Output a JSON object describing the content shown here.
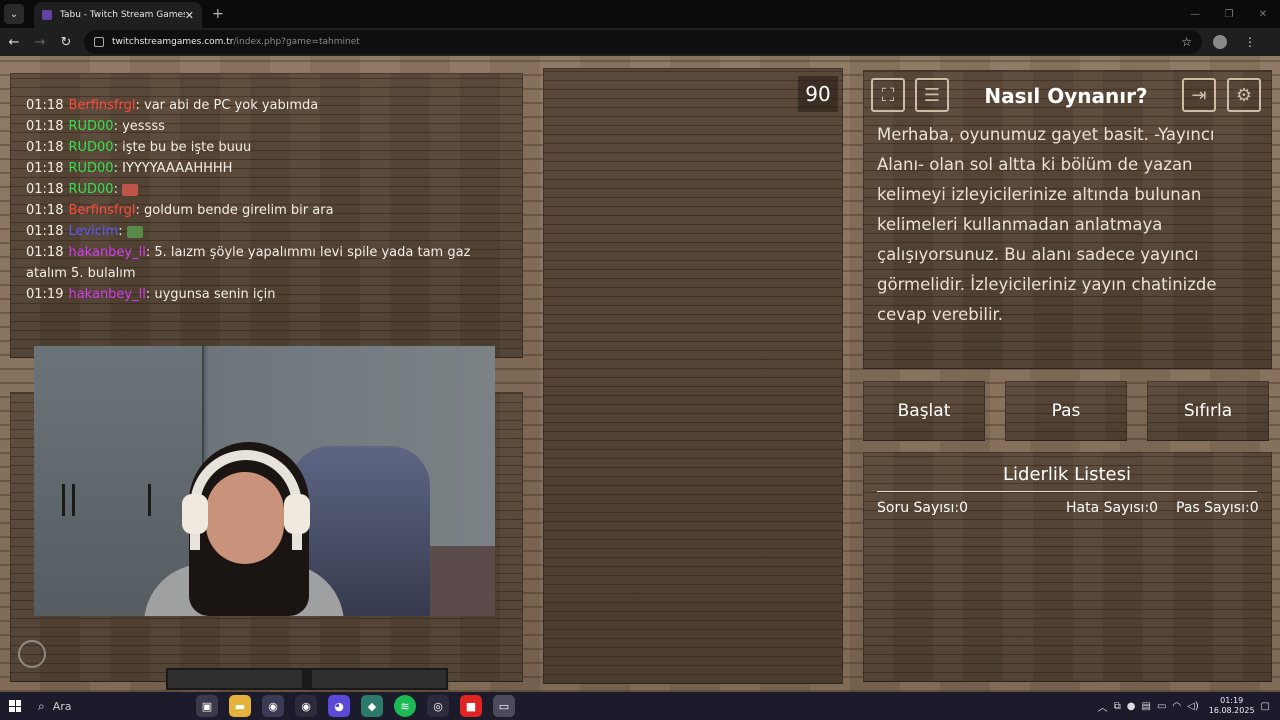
{
  "browser": {
    "tab_title": "Tabu - Twitch Stream Games",
    "url_host": "twitchstreamgames.com.tr",
    "url_path": "/index.php?game=tahminet"
  },
  "chat": [
    {
      "time": "01:18",
      "user": "Berfinsfrgl",
      "color": "#ff4b3a",
      "text": ": var abi de PC yok yabımda"
    },
    {
      "time": "01:18",
      "user": "RUD00",
      "color": "#35e04a",
      "text": ": yessss"
    },
    {
      "time": "01:18",
      "user": "RUD00",
      "color": "#35e04a",
      "text": ": işte bu be işte buuu"
    },
    {
      "time": "01:18",
      "user": "RUD00",
      "color": "#35e04a",
      "text": ": IYYYYAAAAHHHH"
    },
    {
      "time": "01:18",
      "user": "RUD00",
      "color": "#35e04a",
      "text": ": ",
      "emote": true
    },
    {
      "time": "01:18",
      "user": "Berfinsfrgl",
      "color": "#ff4b3a",
      "text": ": goldum bende girelim bir ara"
    },
    {
      "time": "01:18",
      "user": "Levicim",
      "color": "#5a5cff",
      "text": ": ",
      "emote": true
    },
    {
      "time": "01:18",
      "user": "hakanbey_ll",
      "color": "#d43cf0",
      "text": ": 5. laızm şöyle yapalımmı levi spile yada tam gaz atalım 5. bulalım"
    },
    {
      "time": "01:19",
      "user": "hakanbey_ll",
      "color": "#d43cf0",
      "text": ": uygunsa senin için"
    }
  ],
  "timer": "90",
  "help": {
    "title": "Nasıl Oynanır?",
    "text": "Merhaba, oyunumuz gayet basit. -Yayıncı Alanı- olan sol altta ki bölüm de yazan kelimeyi izleyicilerinize altında bulunan kelimeleri kullanmadan anlatmaya çalışıyorsunuz. Bu alanı sadece yayıncı görmelidir. İzleyicileriniz yayın chatinizde cevap verebilir."
  },
  "buttons": {
    "start": "Başlat",
    "pass": "Pas",
    "reset": "Sıfırla"
  },
  "leaderboard": {
    "title": "Liderlik Listesi",
    "questions_label": "Soru Sayısı:",
    "questions_value": "0",
    "errors_label": "Hata Sayısı:",
    "errors_value": "0",
    "passes_label": "Pas Sayısı:",
    "passes_value": "0"
  },
  "taskbar": {
    "search_label": "Ara",
    "time": "01:19",
    "date": "16.08.2025"
  },
  "icons": {
    "fullscreen": "fullscreen-icon",
    "notes": "document-icon",
    "exit": "exit-icon",
    "settings": "gear-icon"
  }
}
